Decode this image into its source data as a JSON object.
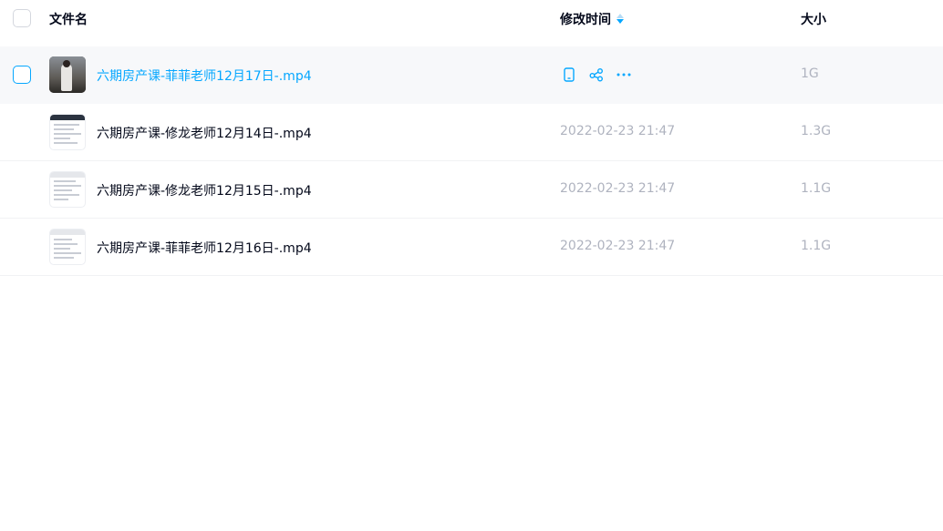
{
  "header": {
    "name_label": "文件名",
    "time_label": "修改时间",
    "size_label": "大小"
  },
  "files": [
    {
      "name": "六期房产课-菲菲老师12月17日-.mp4",
      "modified": "",
      "size": "1G",
      "selected": true
    },
    {
      "name": "六期房产课-修龙老师12月14日-.mp4",
      "modified": "2022-02-23 21:47",
      "size": "1.3G"
    },
    {
      "name": "六期房产课-修龙老师12月15日-.mp4",
      "modified": "2022-02-23 21:47",
      "size": "1.1G"
    },
    {
      "name": "六期房产课-菲菲老师12月16日-.mp4",
      "modified": "2022-02-23 21:47",
      "size": "1.1G"
    }
  ],
  "icons": {
    "row_actions": [
      "phone-icon",
      "share-icon",
      "more-icon"
    ],
    "sort": "sort-icon"
  },
  "colors": {
    "accent": "#06a7ff",
    "text_primary": "#03081a",
    "text_muted": "#afb3bf",
    "selected_row_bg": "#f7f8fa"
  }
}
